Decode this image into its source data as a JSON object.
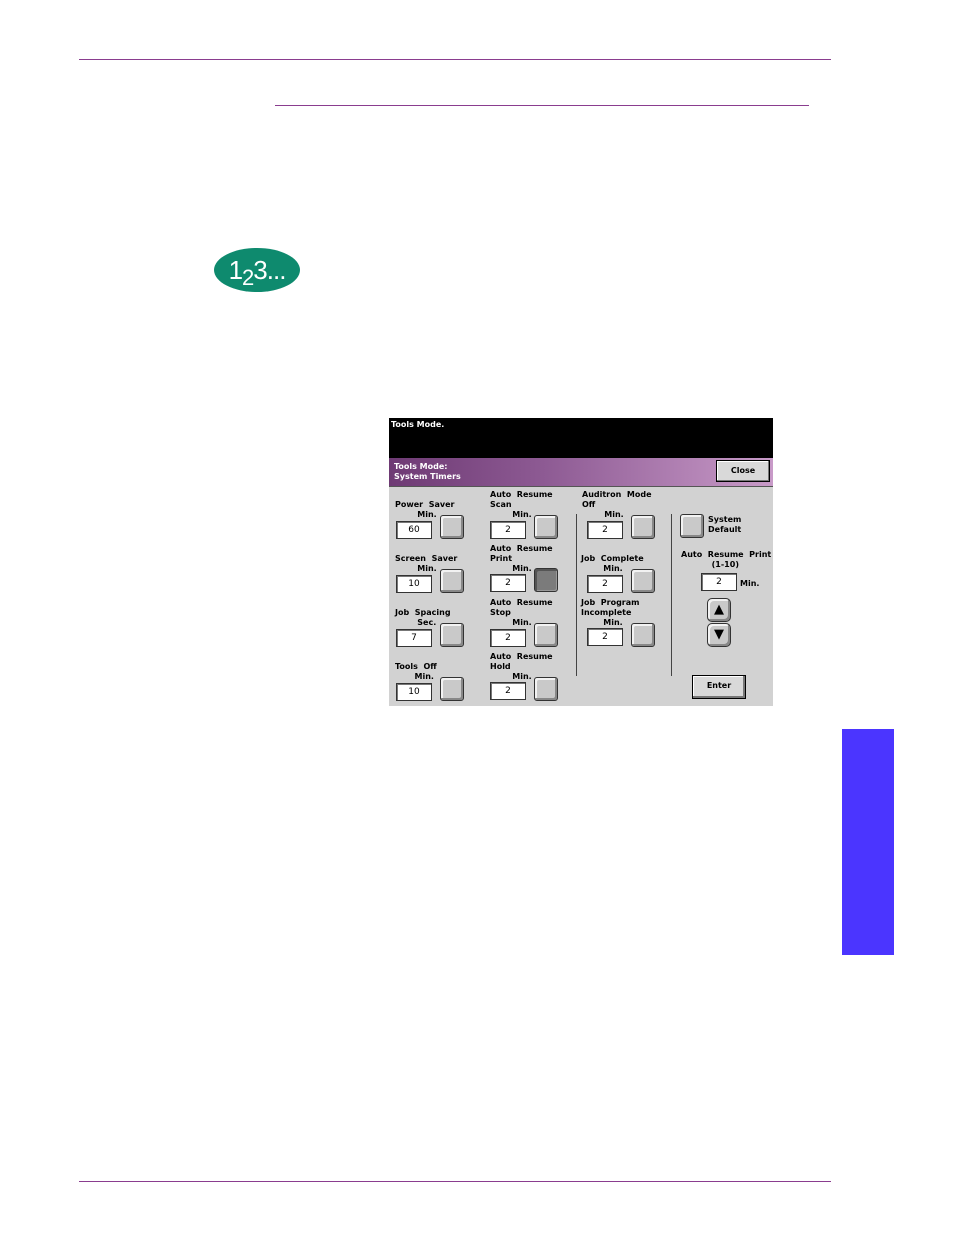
{
  "badge": {
    "main_a": "1",
    "main_b": "2",
    "main_c": "3..."
  },
  "colors": {
    "rule": "#8a3d8f",
    "badge": "#0e8a6e",
    "side_tab": "#4b35ff"
  },
  "screen": {
    "message": "Tools  Mode.",
    "title": "Tools  Mode:\nSystem  Timers",
    "close_label": "Close",
    "timers": {
      "power_saver": {
        "label": "Power  Saver\n        Min.",
        "value": "60"
      },
      "screen_saver": {
        "label": "Screen  Saver\n        Min.",
        "value": "10"
      },
      "job_spacing": {
        "label": "Job  Spacing\n        Sec.",
        "value": "7"
      },
      "tools_off": {
        "label": "Tools  Off\n       Min.",
        "value": "10"
      },
      "ar_scan": {
        "label": "Auto  Resume\nScan\n        Min.",
        "value": "2"
      },
      "ar_print": {
        "label": "Auto  Resume\nPrint\n        Min.",
        "value": "2"
      },
      "ar_stop": {
        "label": "Auto  Resume\nStop\n        Min.",
        "value": "2"
      },
      "ar_hold": {
        "label": "Auto  Resume\nHold\n        Min.",
        "value": "2"
      },
      "auditron": {
        "label": "Auditron  Mode\nOff\n        Min.",
        "value": "2"
      },
      "job_complete": {
        "label": "Job  Complete\n        Min.",
        "value": "2"
      },
      "job_program": {
        "label": "Job  Program\nIncomplete\n        Min.",
        "value": "2"
      }
    },
    "system_default": "System\nDefault",
    "edit": {
      "label": "Auto  Resume  Print\n           (1-10)",
      "value": "2",
      "unit": "Min."
    },
    "up_icon": "▲",
    "down_icon": "▼",
    "enter_label": "Enter"
  }
}
